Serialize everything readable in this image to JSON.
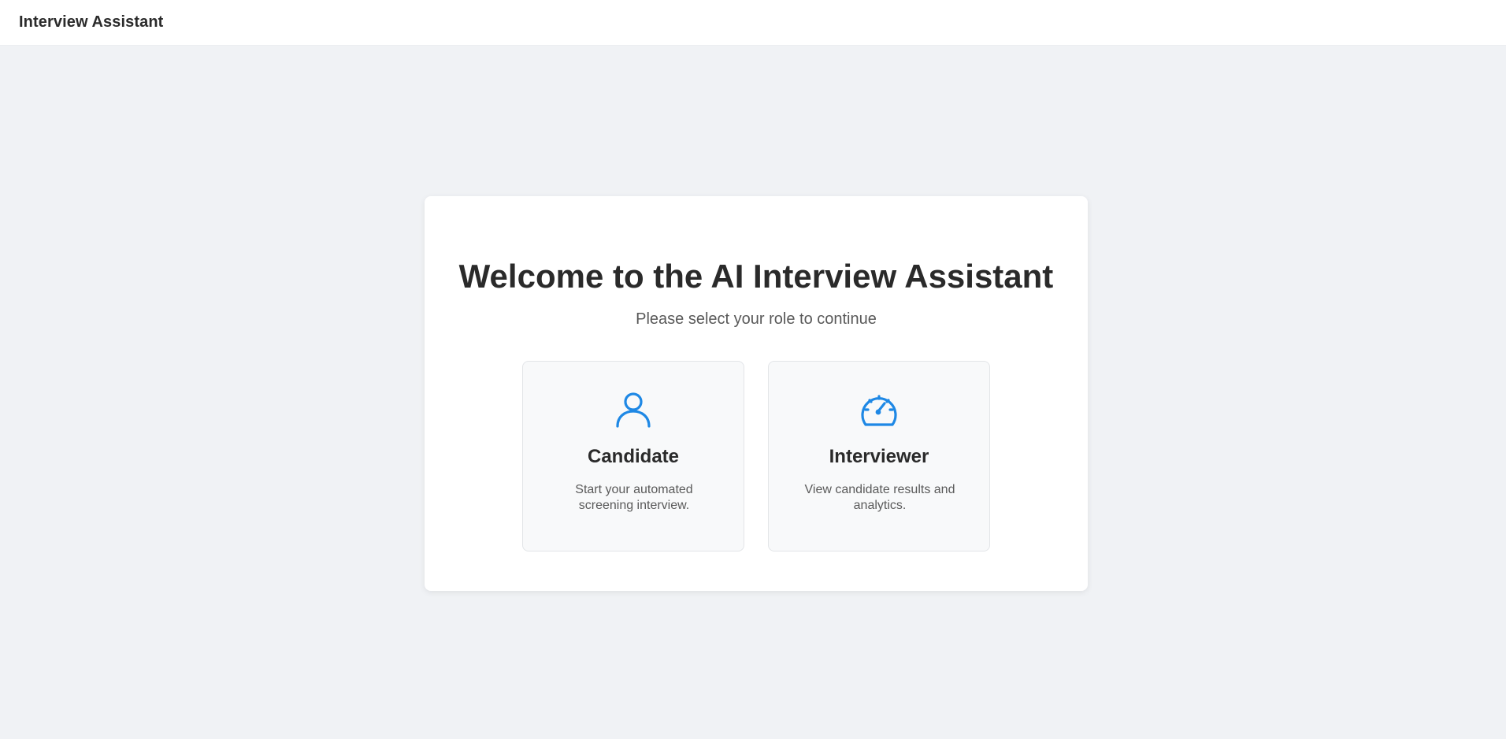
{
  "header": {
    "title": "Interview Assistant"
  },
  "welcome": {
    "title": "Welcome to the AI Interview Assistant",
    "subtitle": "Please select your role to continue"
  },
  "roles": [
    {
      "title": "Candidate",
      "description": "Start your automated screening interview.",
      "icon": "user-icon"
    },
    {
      "title": "Interviewer",
      "description": "View candidate results and analytics.",
      "icon": "dashboard-icon"
    }
  ],
  "colors": {
    "accent": "#1e88e5",
    "background": "#f0f2f5",
    "card": "#ffffff",
    "role_card": "#f8f9fa"
  }
}
